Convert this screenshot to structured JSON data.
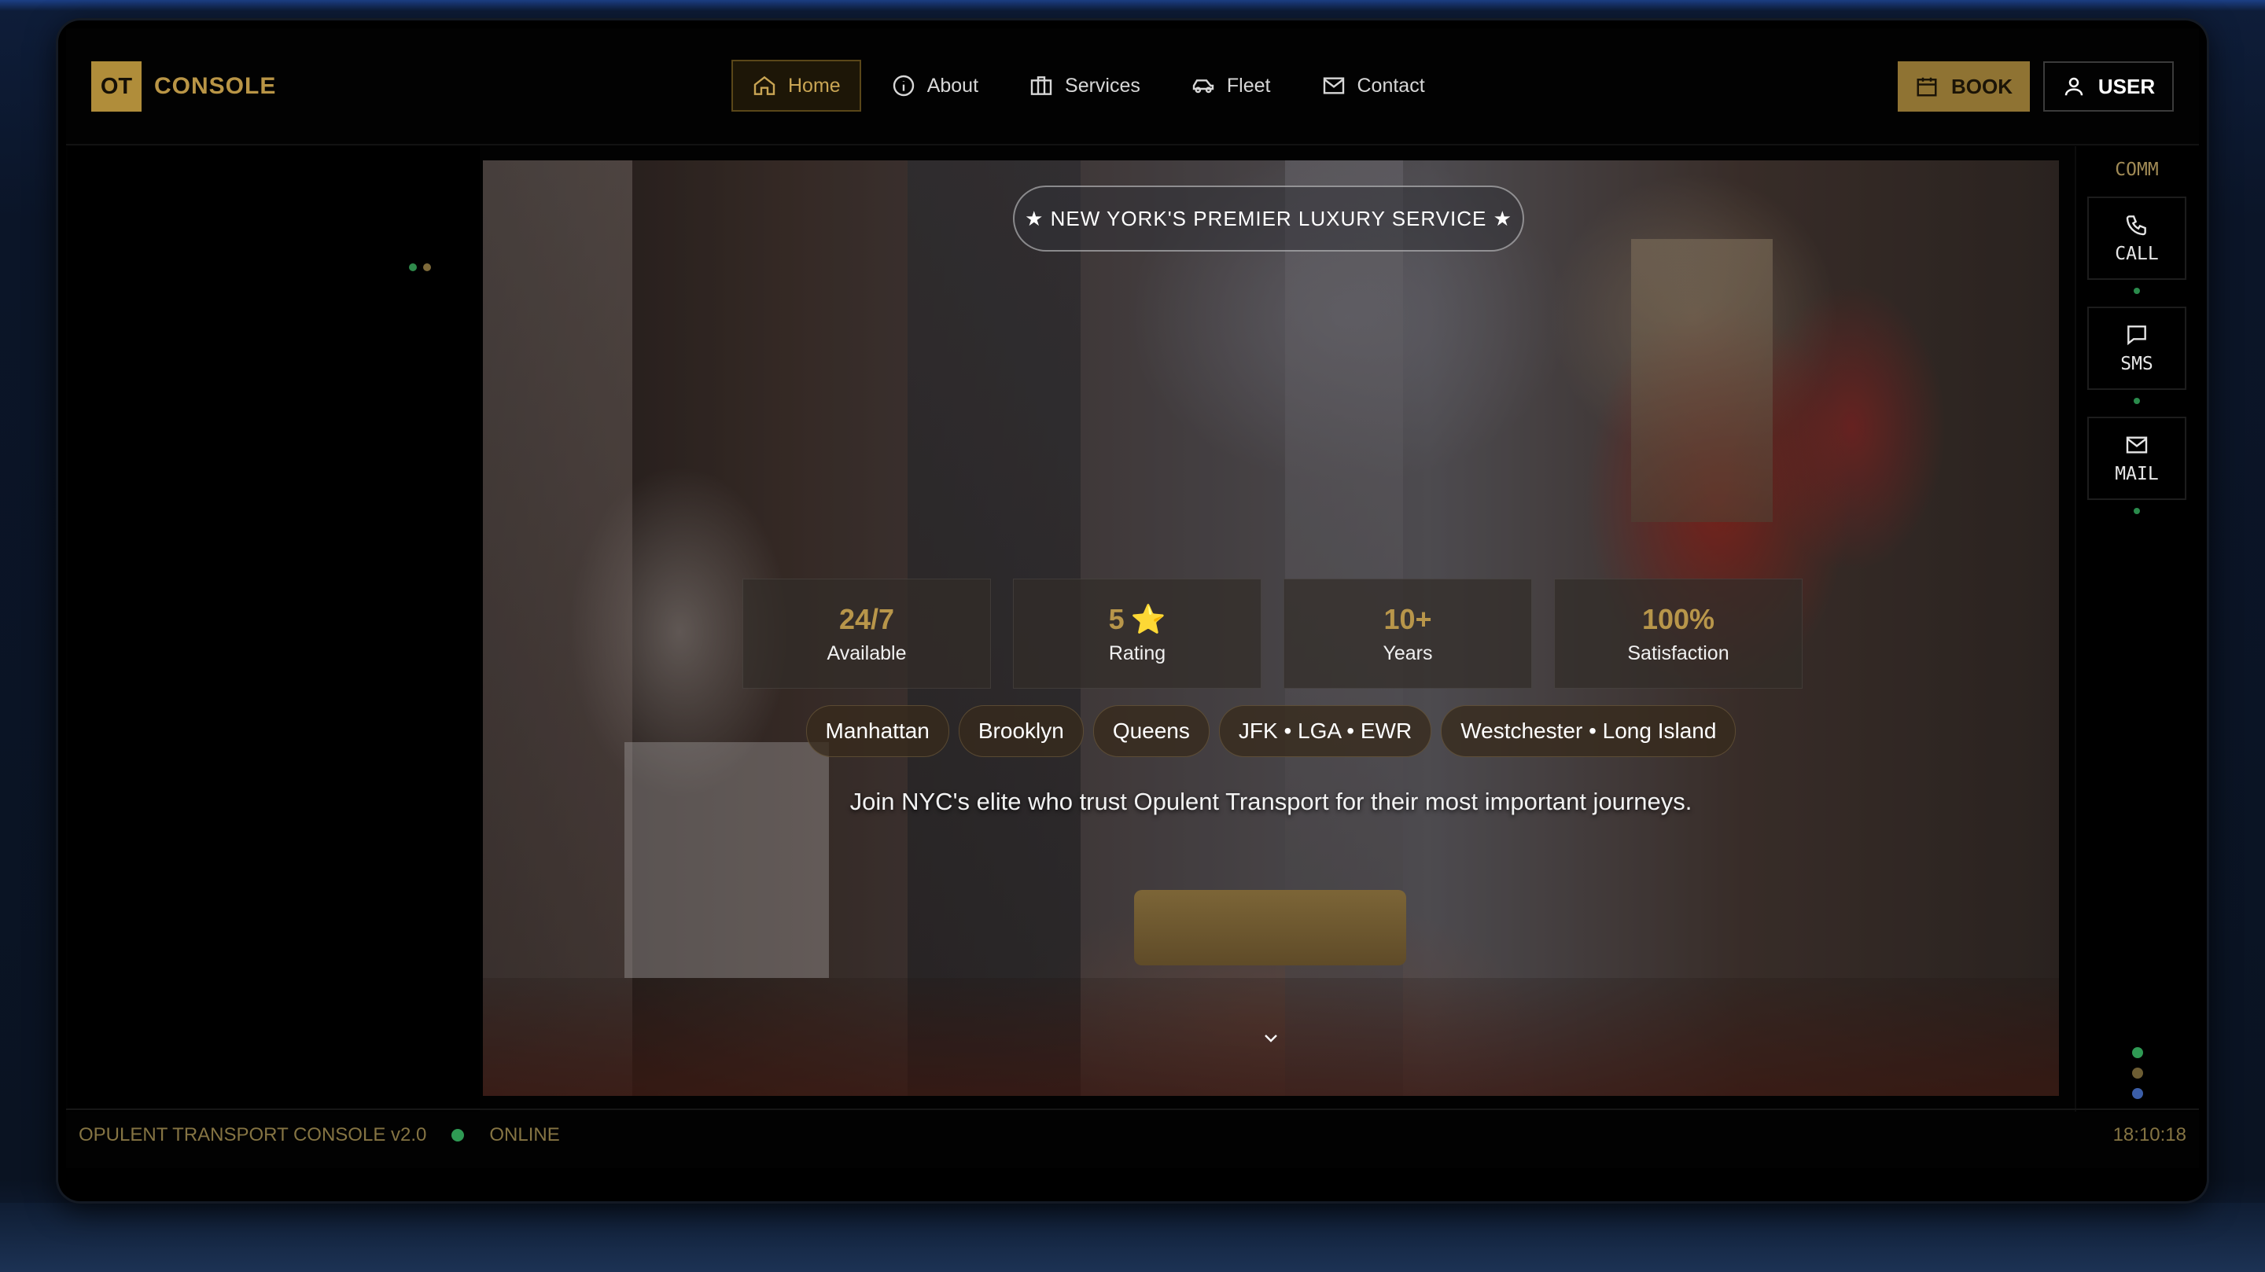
{
  "logo": {
    "mark": "OT",
    "text": "CONSOLE"
  },
  "nav": {
    "items": [
      {
        "label": "Home",
        "icon": "home-icon",
        "active": true
      },
      {
        "label": "About",
        "icon": "info-icon",
        "active": false
      },
      {
        "label": "Services",
        "icon": "briefcase-icon",
        "active": false
      },
      {
        "label": "Fleet",
        "icon": "car-icon",
        "active": false
      },
      {
        "label": "Contact",
        "icon": "mail-icon",
        "active": false
      }
    ]
  },
  "actions": {
    "book_label": "BOOK",
    "user_label": "USER"
  },
  "hero": {
    "badge": "★ NEW YORK'S PREMIER LUXURY SERVICE ★",
    "stats": [
      {
        "value": "24/7",
        "label": "Available"
      },
      {
        "value": "5",
        "label": "Rating",
        "star": "⭐"
      },
      {
        "value": "10+",
        "label": "Years"
      },
      {
        "value": "100%",
        "label": "Satisfaction"
      }
    ],
    "areas": [
      "Manhattan",
      "Brooklyn",
      "Queens",
      "JFK • LGA • EWR",
      "Westchester • Long Island"
    ],
    "tagline": "Join NYC's elite who trust Opulent Transport for their most important journeys."
  },
  "comm": {
    "title": "COMM",
    "buttons": [
      {
        "label": "CALL",
        "icon": "phone-icon"
      },
      {
        "label": "SMS",
        "icon": "message-icon"
      },
      {
        "label": "MAIL",
        "icon": "mail-icon"
      }
    ]
  },
  "footer": {
    "version": "OPULENT TRANSPORT CONSOLE v2.0",
    "status": "ONLINE",
    "time": "18:10:18"
  },
  "colors": {
    "accent": "#b08d3a",
    "online": "#2f9a54",
    "panel": "#000000"
  }
}
